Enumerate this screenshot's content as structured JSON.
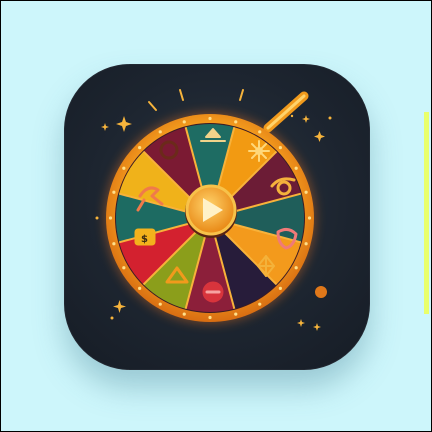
{
  "app_icon": {
    "subject": "prize-wheel",
    "segment_colors": [
      "#1e6c63",
      "#f29a12",
      "#6c1c36",
      "#1f5e5a",
      "#f39a1c",
      "#271c3a",
      "#8c1f3a",
      "#8b9e1b",
      "#d3212f",
      "#1d6b62",
      "#f0b21a",
      "#7b1a33"
    ],
    "rim_color": "#f7a21f",
    "pointer_color": "#f19a1c",
    "background_color": "#cdf6fb",
    "tile_color": "#1d2530",
    "icons": [
      "triangle-up-icon",
      "sun-icon",
      "bow-icon",
      "horn-icon",
      "shield-icon",
      "circle-minus-icon",
      "triangle-icon",
      "ticket-icon",
      "dragon-icon",
      "circle-icon",
      "play-icon"
    ]
  }
}
